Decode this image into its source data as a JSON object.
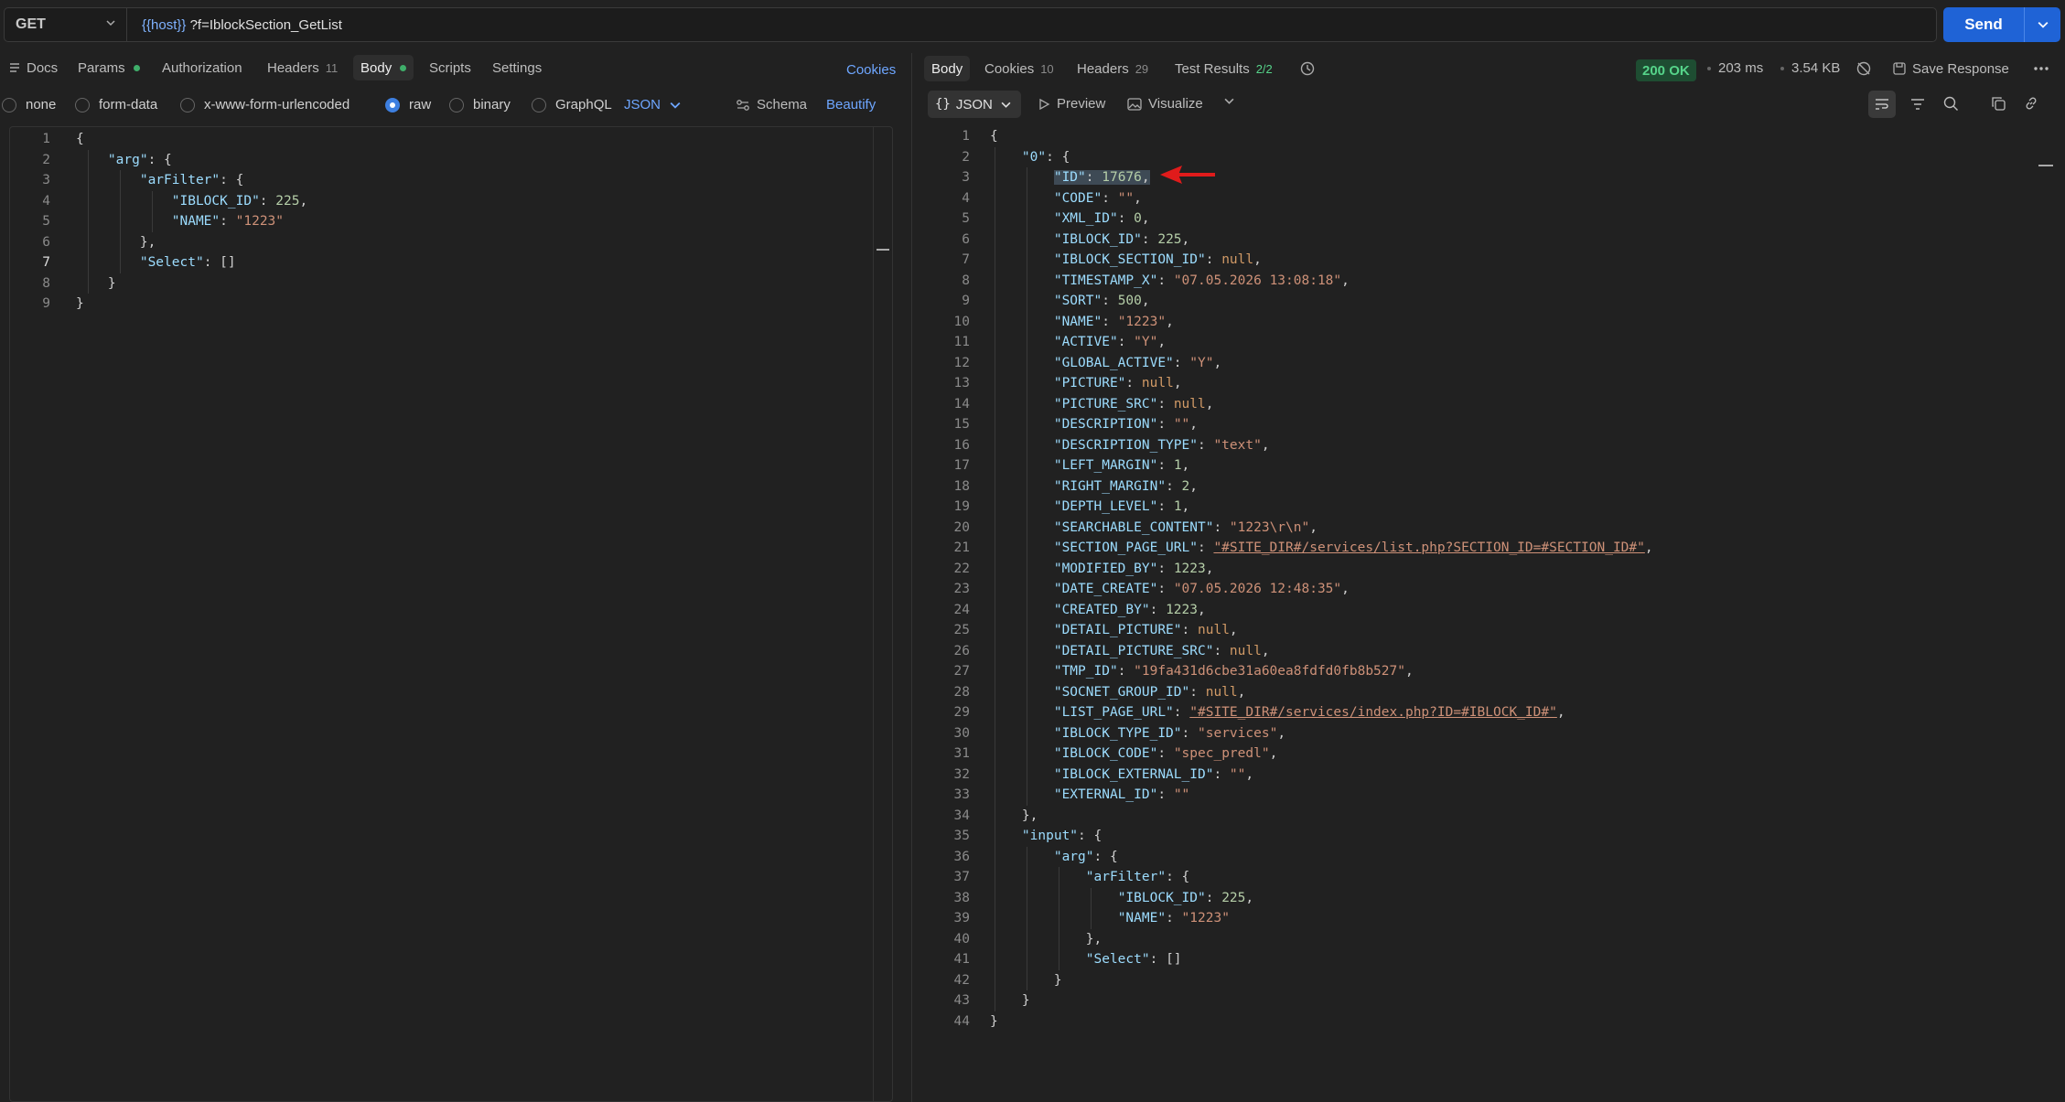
{
  "request": {
    "method": "GET",
    "url_var": "{{host}}",
    "url_rest": " ?f=IblockSection_GetList",
    "send_label": "Send"
  },
  "left_tabs": {
    "docs": "Docs",
    "params": "Params",
    "authorization": "Authorization",
    "headers": "Headers",
    "headers_count": "11",
    "body": "Body",
    "scripts": "Scripts",
    "settings": "Settings",
    "cookies": "Cookies"
  },
  "body_options": {
    "none": "none",
    "form_data": "form-data",
    "urlencoded": "x-www-form-urlencoded",
    "raw": "raw",
    "binary": "binary",
    "graphql": "GraphQL",
    "format": "JSON",
    "schema": "Schema",
    "beautify": "Beautify"
  },
  "right_tabs": {
    "body": "Body",
    "cookies": "Cookies",
    "cookies_count": "10",
    "headers": "Headers",
    "headers_count": "29",
    "tests": "Test Results",
    "tests_count": "2/2",
    "status": "200 OK",
    "time": "203 ms",
    "size": "3.54 KB",
    "save": "Save Response"
  },
  "response_tools": {
    "format": "JSON",
    "preview": "Preview",
    "visualize": "Visualize"
  },
  "request_body_lines": [
    [
      [
        "p",
        "{"
      ]
    ],
    [
      [
        "p",
        "    "
      ],
      [
        "k",
        "\"arg\""
      ],
      [
        "p",
        ": {"
      ]
    ],
    [
      [
        "p",
        "        "
      ],
      [
        "k",
        "\"arFilter\""
      ],
      [
        "p",
        ": {"
      ]
    ],
    [
      [
        "p",
        "            "
      ],
      [
        "k",
        "\"IBLOCK_ID\""
      ],
      [
        "p",
        ": "
      ],
      [
        "n",
        "225"
      ],
      [
        "p",
        ","
      ]
    ],
    [
      [
        "p",
        "            "
      ],
      [
        "k",
        "\"NAME\""
      ],
      [
        "p",
        ": "
      ],
      [
        "s",
        "\"1223\""
      ]
    ],
    [
      [
        "p",
        "        },"
      ]
    ],
    [
      [
        "p",
        "        "
      ],
      [
        "k",
        "\"Select\""
      ],
      [
        "p",
        ": []"
      ]
    ],
    [
      [
        "p",
        "    }"
      ]
    ],
    [
      [
        "p",
        "}"
      ]
    ]
  ],
  "response_lines": [
    [
      [
        "p",
        "{"
      ]
    ],
    [
      [
        "p",
        "    "
      ],
      [
        "k",
        "\"0\""
      ],
      [
        "p",
        ": {"
      ]
    ],
    [
      [
        "p",
        "        "
      ],
      [
        "k",
        "\"ID\""
      ],
      [
        "p",
        ": "
      ],
      [
        "n",
        "17676"
      ],
      [
        "p",
        ","
      ]
    ],
    [
      [
        "p",
        "        "
      ],
      [
        "k",
        "\"CODE\""
      ],
      [
        "p",
        ": "
      ],
      [
        "s",
        "\"\""
      ],
      [
        "p",
        ","
      ]
    ],
    [
      [
        "p",
        "        "
      ],
      [
        "k",
        "\"XML_ID\""
      ],
      [
        "p",
        ": "
      ],
      [
        "n",
        "0"
      ],
      [
        "p",
        ","
      ]
    ],
    [
      [
        "p",
        "        "
      ],
      [
        "k",
        "\"IBLOCK_ID\""
      ],
      [
        "p",
        ": "
      ],
      [
        "n",
        "225"
      ],
      [
        "p",
        ","
      ]
    ],
    [
      [
        "p",
        "        "
      ],
      [
        "k",
        "\"IBLOCK_SECTION_ID\""
      ],
      [
        "p",
        ": "
      ],
      [
        "nl",
        "null"
      ],
      [
        "p",
        ","
      ]
    ],
    [
      [
        "p",
        "        "
      ],
      [
        "k",
        "\"TIMESTAMP_X\""
      ],
      [
        "p",
        ": "
      ],
      [
        "s",
        "\"07.05.2026 13:08:18\""
      ],
      [
        "p",
        ","
      ]
    ],
    [
      [
        "p",
        "        "
      ],
      [
        "k",
        "\"SORT\""
      ],
      [
        "p",
        ": "
      ],
      [
        "n",
        "500"
      ],
      [
        "p",
        ","
      ]
    ],
    [
      [
        "p",
        "        "
      ],
      [
        "k",
        "\"NAME\""
      ],
      [
        "p",
        ": "
      ],
      [
        "s",
        "\"1223\""
      ],
      [
        "p",
        ","
      ]
    ],
    [
      [
        "p",
        "        "
      ],
      [
        "k",
        "\"ACTIVE\""
      ],
      [
        "p",
        ": "
      ],
      [
        "s",
        "\"Y\""
      ],
      [
        "p",
        ","
      ]
    ],
    [
      [
        "p",
        "        "
      ],
      [
        "k",
        "\"GLOBAL_ACTIVE\""
      ],
      [
        "p",
        ": "
      ],
      [
        "s",
        "\"Y\""
      ],
      [
        "p",
        ","
      ]
    ],
    [
      [
        "p",
        "        "
      ],
      [
        "k",
        "\"PICTURE\""
      ],
      [
        "p",
        ": "
      ],
      [
        "nl",
        "null"
      ],
      [
        "p",
        ","
      ]
    ],
    [
      [
        "p",
        "        "
      ],
      [
        "k",
        "\"PICTURE_SRC\""
      ],
      [
        "p",
        ": "
      ],
      [
        "nl",
        "null"
      ],
      [
        "p",
        ","
      ]
    ],
    [
      [
        "p",
        "        "
      ],
      [
        "k",
        "\"DESCRIPTION\""
      ],
      [
        "p",
        ": "
      ],
      [
        "s",
        "\"\""
      ],
      [
        "p",
        ","
      ]
    ],
    [
      [
        "p",
        "        "
      ],
      [
        "k",
        "\"DESCRIPTION_TYPE\""
      ],
      [
        "p",
        ": "
      ],
      [
        "s",
        "\"text\""
      ],
      [
        "p",
        ","
      ]
    ],
    [
      [
        "p",
        "        "
      ],
      [
        "k",
        "\"LEFT_MARGIN\""
      ],
      [
        "p",
        ": "
      ],
      [
        "n",
        "1"
      ],
      [
        "p",
        ","
      ]
    ],
    [
      [
        "p",
        "        "
      ],
      [
        "k",
        "\"RIGHT_MARGIN\""
      ],
      [
        "p",
        ": "
      ],
      [
        "n",
        "2"
      ],
      [
        "p",
        ","
      ]
    ],
    [
      [
        "p",
        "        "
      ],
      [
        "k",
        "\"DEPTH_LEVEL\""
      ],
      [
        "p",
        ": "
      ],
      [
        "n",
        "1"
      ],
      [
        "p",
        ","
      ]
    ],
    [
      [
        "p",
        "        "
      ],
      [
        "k",
        "\"SEARCHABLE_CONTENT\""
      ],
      [
        "p",
        ": "
      ],
      [
        "s",
        "\"1223\\r\\n\""
      ],
      [
        "p",
        ","
      ]
    ],
    [
      [
        "p",
        "        "
      ],
      [
        "k",
        "\"SECTION_PAGE_URL\""
      ],
      [
        "p",
        ": "
      ],
      [
        "s",
        "\"#SITE_DIR#/services/list.php?SECTION_ID=#SECTION_ID#\""
      ],
      [
        "p",
        ","
      ]
    ],
    [
      [
        "p",
        "        "
      ],
      [
        "k",
        "\"MODIFIED_BY\""
      ],
      [
        "p",
        ": "
      ],
      [
        "n",
        "1223"
      ],
      [
        "p",
        ","
      ]
    ],
    [
      [
        "p",
        "        "
      ],
      [
        "k",
        "\"DATE_CREATE\""
      ],
      [
        "p",
        ": "
      ],
      [
        "s",
        "\"07.05.2026 12:48:35\""
      ],
      [
        "p",
        ","
      ]
    ],
    [
      [
        "p",
        "        "
      ],
      [
        "k",
        "\"CREATED_BY\""
      ],
      [
        "p",
        ": "
      ],
      [
        "n",
        "1223"
      ],
      [
        "p",
        ","
      ]
    ],
    [
      [
        "p",
        "        "
      ],
      [
        "k",
        "\"DETAIL_PICTURE\""
      ],
      [
        "p",
        ": "
      ],
      [
        "nl",
        "null"
      ],
      [
        "p",
        ","
      ]
    ],
    [
      [
        "p",
        "        "
      ],
      [
        "k",
        "\"DETAIL_PICTURE_SRC\""
      ],
      [
        "p",
        ": "
      ],
      [
        "nl",
        "null"
      ],
      [
        "p",
        ","
      ]
    ],
    [
      [
        "p",
        "        "
      ],
      [
        "k",
        "\"TMP_ID\""
      ],
      [
        "p",
        ": "
      ],
      [
        "s",
        "\"19fa431d6cbe31a60ea8fdfd0fb8b527\""
      ],
      [
        "p",
        ","
      ]
    ],
    [
      [
        "p",
        "        "
      ],
      [
        "k",
        "\"SOCNET_GROUP_ID\""
      ],
      [
        "p",
        ": "
      ],
      [
        "nl",
        "null"
      ],
      [
        "p",
        ","
      ]
    ],
    [
      [
        "p",
        "        "
      ],
      [
        "k",
        "\"LIST_PAGE_URL\""
      ],
      [
        "p",
        ": "
      ],
      [
        "s",
        "\"#SITE_DIR#/services/index.php?ID=#IBLOCK_ID#\""
      ],
      [
        "p",
        ","
      ]
    ],
    [
      [
        "p",
        "        "
      ],
      [
        "k",
        "\"IBLOCK_TYPE_ID\""
      ],
      [
        "p",
        ": "
      ],
      [
        "s",
        "\"services\""
      ],
      [
        "p",
        ","
      ]
    ],
    [
      [
        "p",
        "        "
      ],
      [
        "k",
        "\"IBLOCK_CODE\""
      ],
      [
        "p",
        ": "
      ],
      [
        "s",
        "\"spec_predl\""
      ],
      [
        "p",
        ","
      ]
    ],
    [
      [
        "p",
        "        "
      ],
      [
        "k",
        "\"IBLOCK_EXTERNAL_ID\""
      ],
      [
        "p",
        ": "
      ],
      [
        "s",
        "\"\""
      ],
      [
        "p",
        ","
      ]
    ],
    [
      [
        "p",
        "        "
      ],
      [
        "k",
        "\"EXTERNAL_ID\""
      ],
      [
        "p",
        ": "
      ],
      [
        "s",
        "\"\""
      ]
    ],
    [
      [
        "p",
        "    },"
      ]
    ],
    [
      [
        "p",
        "    "
      ],
      [
        "k",
        "\"input\""
      ],
      [
        "p",
        ": {"
      ]
    ],
    [
      [
        "p",
        "        "
      ],
      [
        "k",
        "\"arg\""
      ],
      [
        "p",
        ": {"
      ]
    ],
    [
      [
        "p",
        "            "
      ],
      [
        "k",
        "\"arFilter\""
      ],
      [
        "p",
        ": {"
      ]
    ],
    [
      [
        "p",
        "                "
      ],
      [
        "k",
        "\"IBLOCK_ID\""
      ],
      [
        "p",
        ": "
      ],
      [
        "n",
        "225"
      ],
      [
        "p",
        ","
      ]
    ],
    [
      [
        "p",
        "                "
      ],
      [
        "k",
        "\"NAME\""
      ],
      [
        "p",
        ": "
      ],
      [
        "s",
        "\"1223\""
      ]
    ],
    [
      [
        "p",
        "            },"
      ]
    ],
    [
      [
        "p",
        "            "
      ],
      [
        "k",
        "\"Select\""
      ],
      [
        "p",
        ": []"
      ]
    ],
    [
      [
        "p",
        "        }"
      ]
    ],
    [
      [
        "p",
        "    }"
      ]
    ],
    [
      [
        "p",
        "}"
      ]
    ]
  ],
  "colors": {
    "accent": "#1f63d6",
    "link": "#6ea6ff",
    "status_ok": "#56d48a",
    "annotation_arrow": "#e01b1b"
  },
  "icons": {
    "docs": "doc-lines-icon",
    "history": "history-icon",
    "no_cookies": "cookie-off-icon",
    "save": "save-response-icon",
    "more": "more-horizontal-icon",
    "wrap": "wrap-lines-icon",
    "filter": "filter-icon",
    "search": "search-icon",
    "copy": "copy-icon",
    "link": "link-icon"
  }
}
